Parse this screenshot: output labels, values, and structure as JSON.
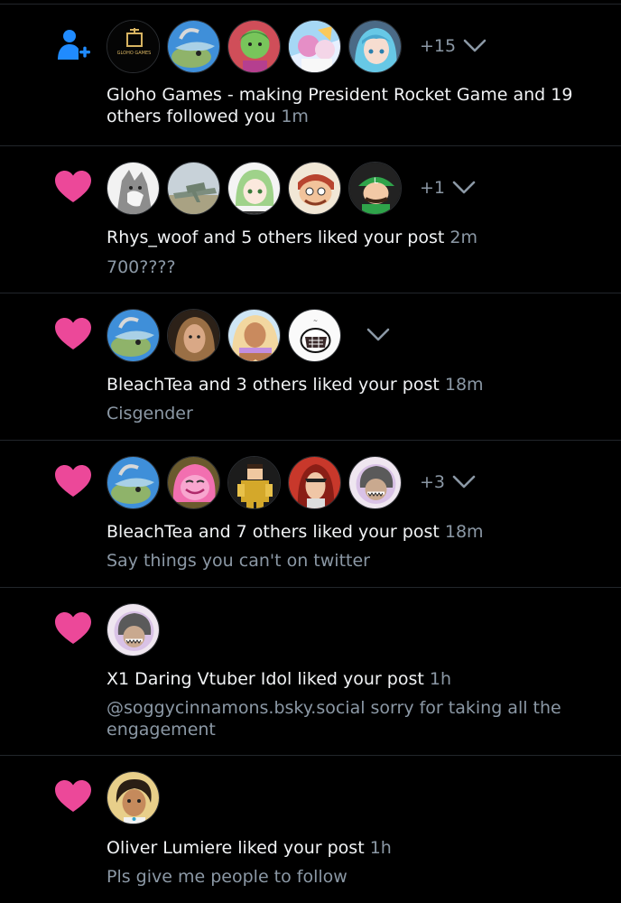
{
  "colors": {
    "background": "#000000",
    "text_primary": "#f1f3f5",
    "text_secondary": "#8b98a5",
    "like": "#ec4899",
    "follow": "#208bfe",
    "divider": "#22262b"
  },
  "notifications": [
    {
      "kind": "follow",
      "icon": "person-plus-icon",
      "avatars": [
        "gloho-games",
        "dragon",
        "green-goblin",
        "pastel-anime",
        "teal-hair-anime"
      ],
      "extra_count": "+15",
      "actor_text": "Gloho Games - making President Rocket Game and 19 others followed you",
      "time": "1m",
      "snippet": "",
      "avatar_logo_text": "GLOHO GAMES"
    },
    {
      "kind": "like",
      "icon": "heart-icon",
      "avatars": [
        "wolf",
        "jet",
        "green-hair",
        "cartoon-man",
        "luigi"
      ],
      "extra_count": "+1",
      "actor_text": "Rhys_woof and 5 others liked your post",
      "time": "2m",
      "snippet": "700????"
    },
    {
      "kind": "like",
      "icon": "heart-icon",
      "avatars": [
        "dragon",
        "photo-man",
        "blonde-anime",
        "drawn-sketch"
      ],
      "extra_count": "",
      "actor_text": "BleachTea and 3 others liked your post",
      "time": "18m",
      "snippet": "Cisgender"
    },
    {
      "kind": "like",
      "icon": "heart-icon",
      "avatars": [
        "dragon",
        "pink-pony",
        "gold-pixel-knight",
        "red-hair-anime",
        "grey-vtuber"
      ],
      "extra_count": "+3",
      "actor_text": "BleachTea and 7 others liked your post",
      "time": "18m",
      "snippet": "Say things you can't on twitter"
    },
    {
      "kind": "like",
      "icon": "heart-icon",
      "avatars": [
        "grey-vtuber"
      ],
      "extra_count": "",
      "actor_text": "X1 Daring Vtuber Idol liked your post",
      "time": "1h",
      "snippet": "@soggycinnamons.bsky.social sorry for taking all the engagement"
    },
    {
      "kind": "like",
      "icon": "heart-icon",
      "avatars": [
        "sketch-boy"
      ],
      "extra_count": "",
      "actor_text": "Oliver Lumiere liked your post",
      "time": "1h",
      "snippet": "Pls give me people to follow"
    }
  ]
}
